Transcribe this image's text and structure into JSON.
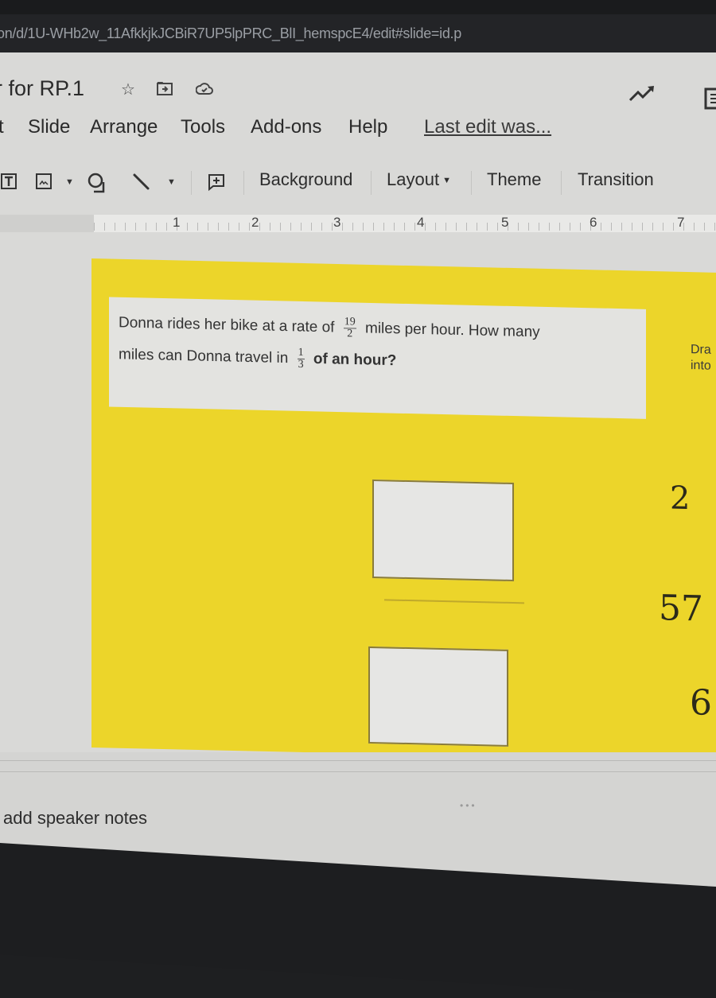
{
  "browser": {
    "url": "on/d/1U-WHb2w_11AfkkjkJCBiR7UP5lpPRC_BlI_hemspcE4/edit#slide=id.p"
  },
  "app": {
    "doc_title": "r for RP.1",
    "title_icons": [
      "star-icon",
      "move-to-folder-icon",
      "cloud-saved-icon"
    ],
    "right_icons": [
      "activity-dashboard-icon",
      "comments-icon"
    ],
    "menu": [
      "t",
      "Slide",
      "Arrange",
      "Tools",
      "Add-ons",
      "Help"
    ],
    "last_edit": "Last edit was..."
  },
  "toolbar": {
    "tools": [
      "text-box-icon",
      "image-icon",
      "shape-icon",
      "line-icon",
      "add-comment-icon"
    ],
    "buttons": {
      "background": "Background",
      "layout": "Layout",
      "theme": "Theme",
      "transition": "Transition"
    }
  },
  "ruler": {
    "marks": [
      "1",
      "2",
      "3",
      "4",
      "5",
      "6",
      "7"
    ]
  },
  "slide": {
    "background_color": "#ecd52a",
    "question": {
      "part1": "Donna rides her bike at a rate of",
      "frac1_num": "19",
      "frac1_den": "2",
      "part2": "miles per hour.  How many",
      "part3": "miles can Donna travel in",
      "frac2_num": "1",
      "frac2_den": "3",
      "part4": "of an hour?"
    },
    "answer_boxes": [
      "",
      ""
    ],
    "drag_hint_line1": "Dra",
    "drag_hint_line2": "into",
    "tiles": [
      "2",
      "57",
      "6"
    ]
  },
  "notes": {
    "placeholder": "add speaker notes",
    "resize_handle": "•••"
  }
}
